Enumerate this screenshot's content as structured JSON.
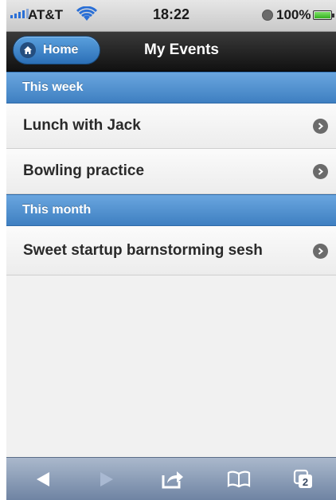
{
  "status_bar": {
    "carrier": "AT&T",
    "time": "18:22",
    "battery_percent": "100%",
    "battery_level": 1.0,
    "icons": [
      "signal-icon",
      "wifi-icon",
      "alarm-icon",
      "battery-icon"
    ]
  },
  "header": {
    "back_label": "Home",
    "title": "My Events",
    "back_icon": "home-icon"
  },
  "sections": [
    {
      "label": "This week",
      "items": [
        "Lunch with Jack",
        "Bowling practice"
      ]
    },
    {
      "label": "This month",
      "items": [
        "Sweet startup barnstorming sesh"
      ]
    }
  ],
  "toolbar": {
    "buttons": [
      "back-arrow-icon",
      "forward-arrow-icon",
      "share-icon",
      "bookmarks-icon",
      "tabs-icon"
    ],
    "tabs_count": "2"
  },
  "colors": {
    "accent": "#4a8bcb",
    "header": "#1a1a1a",
    "toolbar": "#8194b2"
  }
}
